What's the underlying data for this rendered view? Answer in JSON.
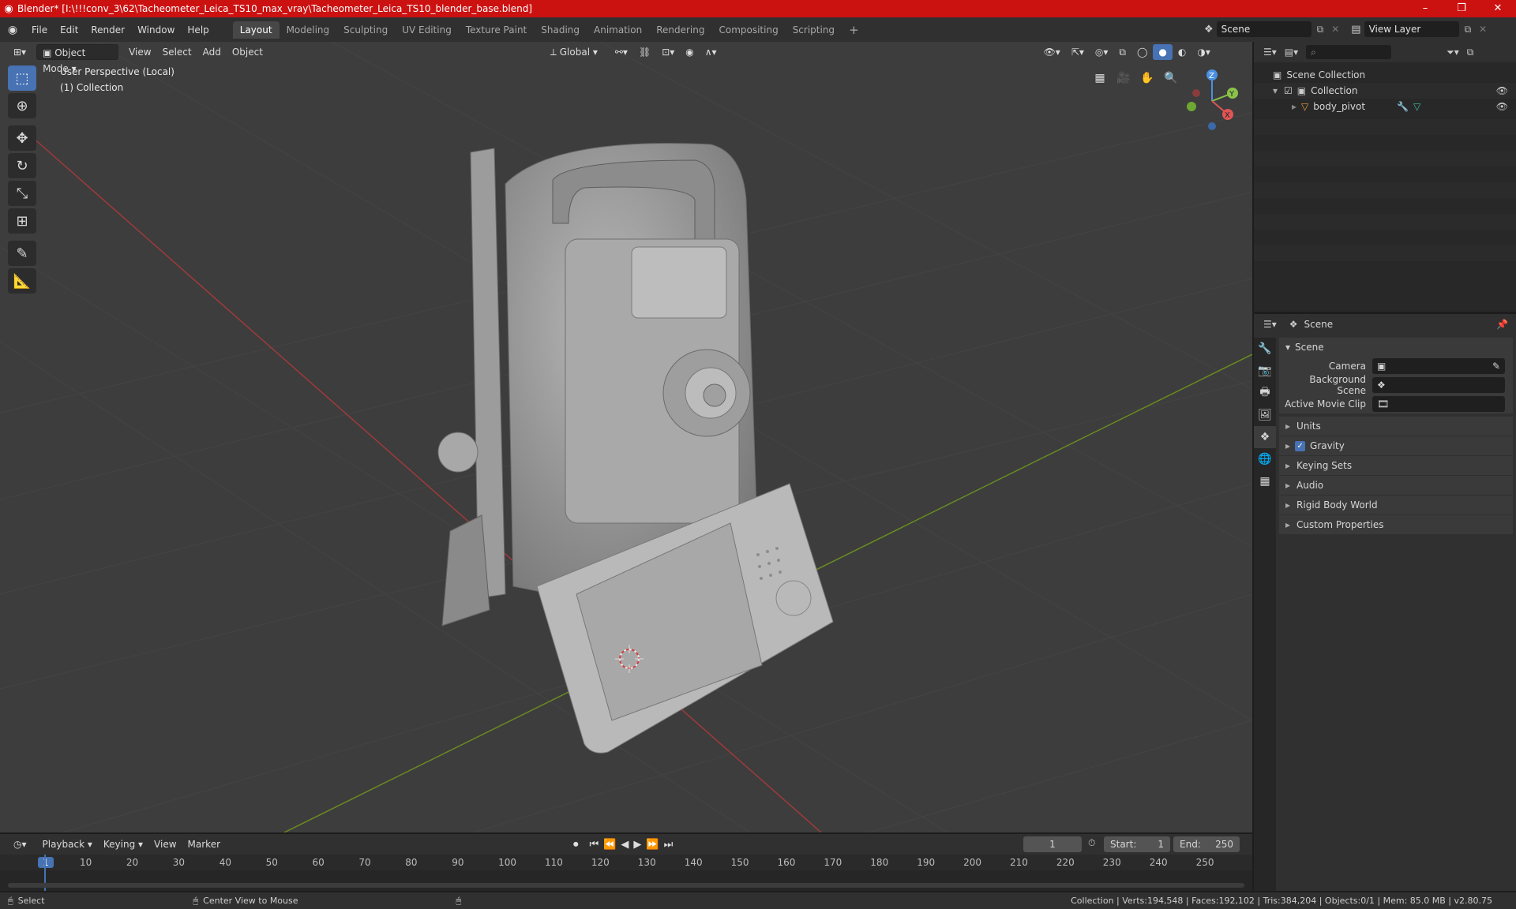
{
  "window": {
    "title": "Blender* [I:\\!!!conv_3\\62\\Tacheometer_Leica_TS10_max_vray\\Tacheometer_Leica_TS10_blender_base.blend]",
    "minimize": "–",
    "maximize": "❐",
    "close": "✕"
  },
  "menu": [
    "File",
    "Edit",
    "Render",
    "Window",
    "Help"
  ],
  "workspaces": [
    "Layout",
    "Modeling",
    "Sculpting",
    "UV Editing",
    "Texture Paint",
    "Shading",
    "Animation",
    "Rendering",
    "Compositing",
    "Scripting"
  ],
  "active_workspace": "Layout",
  "add_workspace": "+",
  "scene_field": "Scene",
  "view_layer_field": "View Layer",
  "viewport": {
    "mode": "Object Mode",
    "menus": [
      "View",
      "Select",
      "Add",
      "Object"
    ],
    "transform_orientation": "Global",
    "perspective_label": "User Perspective (Local)",
    "collection_label": "(1) Collection",
    "gizmo": {
      "z": "Z",
      "y": "Y",
      "x": "X"
    }
  },
  "outliner": {
    "search_placeholder": "",
    "scene_collection": "Scene Collection",
    "collection": "Collection",
    "object": "body_pivot"
  },
  "properties": {
    "context": "Scene",
    "panel_title": "Scene",
    "camera_label": "Camera",
    "background_scene_label": "Background Scene",
    "active_movie_clip_label": "Active Movie Clip",
    "subpanels": [
      "Units",
      "Gravity",
      "Keying Sets",
      "Audio",
      "Rigid Body World",
      "Custom Properties"
    ],
    "gravity_checked": true
  },
  "timeline": {
    "menus": [
      "Playback",
      "Keying",
      "View",
      "Marker"
    ],
    "current_frame": "1",
    "start_label": "Start:",
    "start_value": "1",
    "end_label": "End:",
    "end_value": "250",
    "ruler": [
      "1",
      "10",
      "20",
      "30",
      "40",
      "50",
      "60",
      "70",
      "80",
      "90",
      "100",
      "110",
      "120",
      "130",
      "140",
      "150",
      "160",
      "170",
      "180",
      "190",
      "200",
      "210",
      "220",
      "230",
      "240",
      "250"
    ]
  },
  "status": {
    "select": "Select",
    "center_view": "Center View to Mouse",
    "stats": "Collection | Verts:194,548 | Faces:192,102 | Tris:384,204 | Objects:0/1 | Mem: 85.0 MB | v2.80.75"
  },
  "colors": {
    "title_bar": "#cc1111",
    "active_tool": "#4772b3",
    "x_axis": "#e05555",
    "y_axis": "#8bc34a",
    "z_axis": "#4a90e2"
  }
}
